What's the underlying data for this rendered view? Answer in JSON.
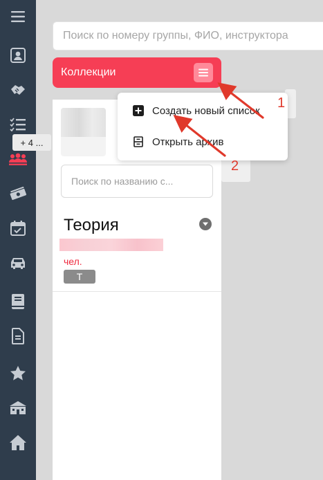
{
  "search": {
    "placeholder": "Поиск по номеру группы, ФИО, инструктора"
  },
  "collections": {
    "title": "Коллекции",
    "menu_icon": "hamburger-icon",
    "more_badge": "+ 4 ...",
    "search_placeholder": "Поиск по названию с...",
    "item": {
      "name": "Теория",
      "members_label": "чел.",
      "tag": "Т"
    }
  },
  "dropdown": {
    "items": [
      {
        "label": "Создать новый список",
        "icon": "plus-square-icon"
      },
      {
        "label": "Открыть архив",
        "icon": "archive-icon"
      }
    ]
  },
  "annotations": {
    "step1": "1",
    "step2": "2"
  },
  "sidebar": {
    "icons": [
      "contact-card-icon",
      "handshake-icon",
      "checklist-icon",
      "group-icon",
      "money-icon",
      "calendar-icon",
      "car-icon",
      "book-icon",
      "document-icon",
      "star-icon",
      "school-icon",
      "home-icon"
    ]
  },
  "colors": {
    "sidebar_bg": "#2f3d4c",
    "accent": "#f63e55",
    "annotation": "#e0392b",
    "page_bg": "#d9d9d9"
  }
}
